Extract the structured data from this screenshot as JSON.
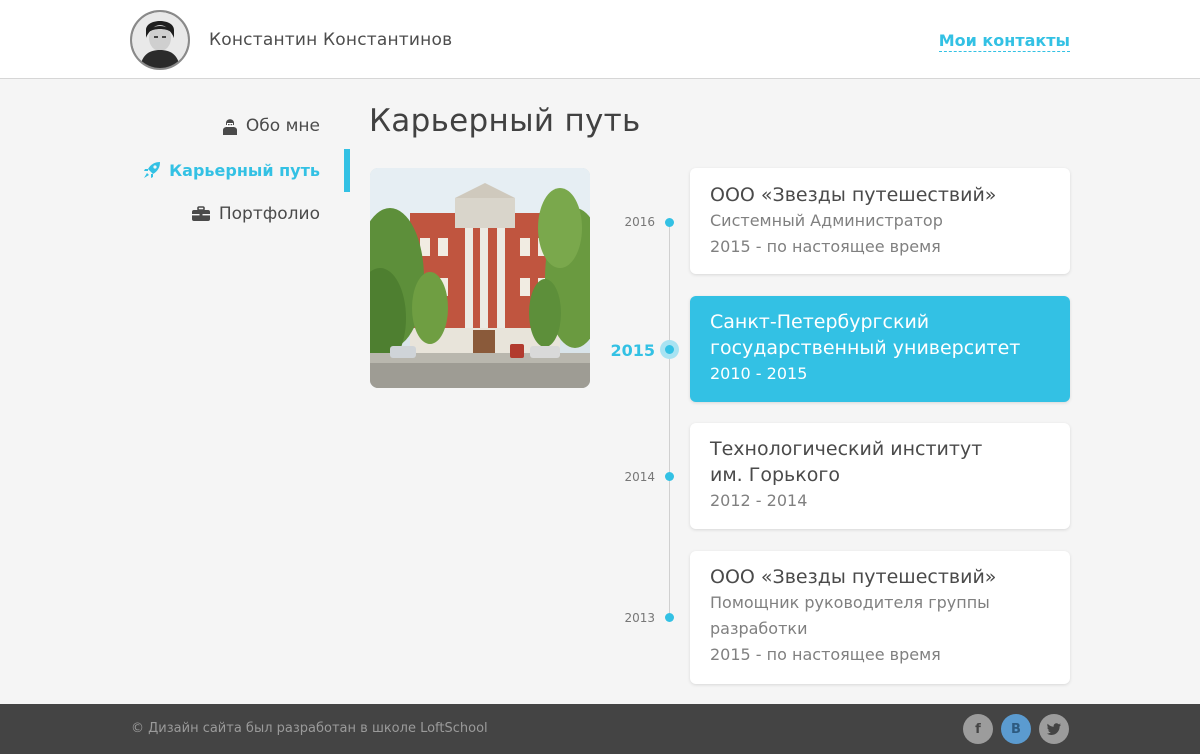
{
  "header": {
    "user_name": "Константин Константинов",
    "contacts_link": "Мои контакты"
  },
  "nav": {
    "items": [
      {
        "label": "Обо мне",
        "icon": "user-icon",
        "active": false
      },
      {
        "label": "Карьерный путь",
        "icon": "rocket-icon",
        "active": true
      },
      {
        "label": "Портфолио",
        "icon": "briefcase-icon",
        "active": false
      }
    ]
  },
  "main": {
    "title": "Карьерный путь",
    "photo_icon": "university-building-photo"
  },
  "timeline": [
    {
      "year": "2016",
      "title": "ООО «Звезды путешествий»",
      "lines": [
        "Системный Администратор",
        "2015 - по настоящее время"
      ],
      "active": false
    },
    {
      "year": "2015",
      "title": "Санкт-Петербургский государственный университет",
      "lines": [
        "2010 - 2015"
      ],
      "active": true
    },
    {
      "year": "2014",
      "title": "Технологический институт им. Горького",
      "lines": [
        "2012 - 2014"
      ],
      "active": false
    },
    {
      "year": "2013",
      "title": "ООО «Звезды путешествий»",
      "lines": [
        "Помощник руководителя группы разработки",
        "2015 - по настоящее время"
      ],
      "active": false
    }
  ],
  "footer": {
    "copyright": "© Дизайн сайта был разработан в школе LoftSchool",
    "social": [
      {
        "label": "f",
        "icon": "facebook-icon"
      },
      {
        "label": "В",
        "icon": "vk-icon"
      },
      {
        "label": "t",
        "icon": "twitter-icon"
      }
    ]
  },
  "colors": {
    "accent": "#33c1e4",
    "background": "#f5f5f5",
    "footer": "#444444"
  }
}
